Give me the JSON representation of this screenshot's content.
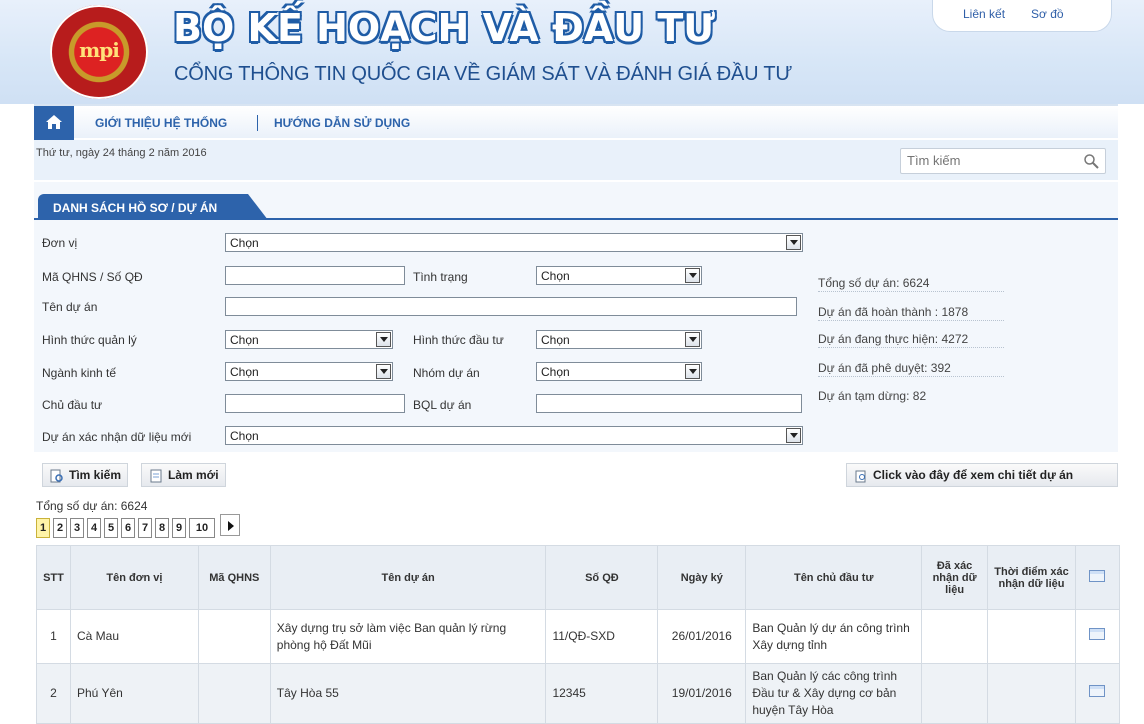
{
  "header": {
    "logo_text": "mpi",
    "title": "BỘ KẾ HOẠCH VÀ ĐẦU TƯ",
    "subtitle": "CỔNG THÔNG TIN QUỐC GIA VỀ GIÁM SÁT VÀ ĐÁNH GIÁ ĐẦU TƯ",
    "links": [
      "Liên kết",
      "Sơ đồ"
    ]
  },
  "nav": {
    "items": [
      "GIỚI THIỆU HỆ THỐNG",
      "HƯỚNG DẪN SỬ DỤNG"
    ]
  },
  "datebar": {
    "date": "Thứ tư, ngày 24 tháng 2 năm 2016",
    "search_placeholder": "Tìm kiếm"
  },
  "panel": {
    "tab": "DANH SÁCH HỒ SƠ / DỰ ÁN",
    "labels": {
      "don_vi": "Đơn vị",
      "ma_qhns": "Mã QHNS / Số QĐ",
      "tinh_trang": "Tình trạng",
      "ten_du_an": "Tên dự án",
      "hinh_thuc_quan_ly": "Hình thức quản lý",
      "hinh_thuc_dau_tu": "Hình thức đầu tư",
      "nganh_kinh_te": "Ngành kinh tế",
      "nhom_du_an": "Nhóm dự án",
      "chu_dau_tu": "Chủ đầu tư",
      "bql_du_an": "BQL dự án",
      "xac_nhan": "Dự án xác nhận dữ liệu mới"
    },
    "select_default": "Chọn",
    "stats": [
      "Tổng số dự án: 6624",
      "Dự án đã hoàn thành : 1878",
      "Dự án đang thực hiện: 4272",
      "Dự án đã phê duyệt: 392",
      "Dự án tạm dừng: 82"
    ],
    "buttons": {
      "search": "Tìm kiếm",
      "reset": "Làm mới",
      "detail": "Click vào đây để xem chi tiết dự án"
    }
  },
  "list": {
    "total": "Tổng số dự án: 6624",
    "pages": [
      "1",
      "2",
      "3",
      "4",
      "5",
      "6",
      "7",
      "8",
      "9",
      "10"
    ],
    "columns": [
      "STT",
      "Tên đơn vị",
      "Mã QHNS",
      "Tên dự án",
      "Số QĐ",
      "Ngày ký",
      "Tên chủ đầu tư",
      "Đã xác nhận dữ liệu",
      "Thời điểm xác nhận dữ liệu"
    ],
    "rows": [
      {
        "stt": "1",
        "don_vi": "Cà Mau",
        "ma_qhns": "",
        "ten_du_an": "Xây dựng trụ sở làm việc Ban quản lý rừng phòng hộ Đất Mũi",
        "so_qd": "11/QĐ-SXD",
        "ngay_ky": "26/01/2016",
        "chu_dau_tu": "Ban Quản lý dự án công trình Xây dựng tỉnh"
      },
      {
        "stt": "2",
        "don_vi": "Phú Yên",
        "ma_qhns": "",
        "ten_du_an": "Tây Hòa 55",
        "so_qd": "12345",
        "ngay_ky": "19/01/2016",
        "chu_dau_tu": "Ban Quản lý các công trình Đầu tư & Xây dựng cơ bản huyện Tây Hòa"
      }
    ]
  }
}
